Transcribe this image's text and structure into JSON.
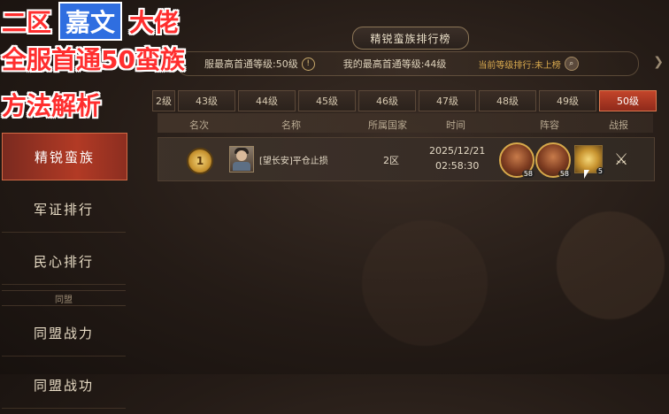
{
  "caption": {
    "line1_a": "二区",
    "line1_b": "嘉文",
    "line1_c": "大佬",
    "line2": "全服首通50蛮族",
    "line3": "方法解析"
  },
  "title": "精锐蛮族排行榜",
  "info": {
    "server_first": "服最高首通等级:50级",
    "my_first": "我的最高首通等级:44级",
    "current_rank": "当前等级排行:未上榜"
  },
  "level_tabs": [
    "2级",
    "43级",
    "44级",
    "45级",
    "46级",
    "47级",
    "48级",
    "49级",
    "50级"
  ],
  "active_level": "50级",
  "columns": [
    "名次",
    "名称",
    "所属国家",
    "时间",
    "阵容",
    "战报"
  ],
  "rows": [
    {
      "rank": "1",
      "name": "[望长安]平仓止损",
      "country": "2区",
      "date": "2025/12/21",
      "time": "02:58:30",
      "hero1_level": "58",
      "hero2_level": "58",
      "skill_level": "5"
    }
  ],
  "sidebar": {
    "items": [
      "精锐蛮族",
      "军证排行",
      "民心排行"
    ],
    "divider": "同盟",
    "items2": [
      "同盟战力",
      "同盟战功"
    ]
  },
  "accent": "#b23a25"
}
